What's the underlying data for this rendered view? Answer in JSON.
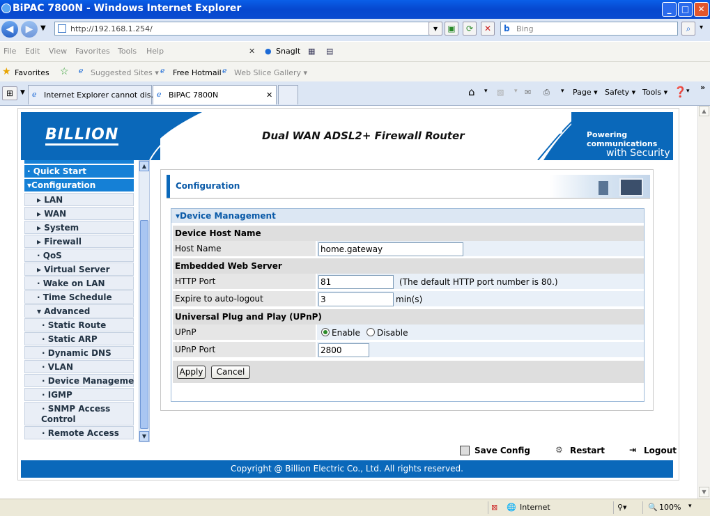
{
  "window": {
    "title": "BiPAC 7800N - Windows Internet Explorer",
    "min": "_",
    "max": "□",
    "close": "✕"
  },
  "addressbar": {
    "url": "http://192.168.1.254/",
    "search_placeholder": "Bing",
    "search_logo": "b"
  },
  "menubar": {
    "items": [
      "File",
      "Edit",
      "View",
      "Favorites",
      "Tools",
      "Help"
    ],
    "snagit": "SnagIt"
  },
  "favorites": {
    "label": "Favorites",
    "items": [
      "Suggested Sites ▾",
      "Free Hotmail",
      "Web Slice Gallery ▾"
    ]
  },
  "tabs": [
    {
      "label": "Internet Explorer cannot dis..."
    },
    {
      "label": "BiPAC 7800N"
    }
  ],
  "commandbar": {
    "page": "Page ▾",
    "safety": "Safety ▾",
    "tools": "Tools ▾"
  },
  "banner": {
    "logo": "BILLION",
    "headline": "Dual WAN ADSL2+ Firewall Router",
    "tagline_1": "Powering communications",
    "tagline_2": "with Security"
  },
  "nav": {
    "items": [
      {
        "label": "· Quick Start",
        "style": "blue"
      },
      {
        "label": "▾Configuration",
        "style": "blue"
      },
      {
        "label": "▸ LAN",
        "style": "light",
        "indent": 1
      },
      {
        "label": "▸ WAN",
        "style": "light",
        "indent": 1
      },
      {
        "label": "▸ System",
        "style": "light",
        "indent": 1
      },
      {
        "label": "▸ Firewall",
        "style": "light",
        "indent": 1
      },
      {
        "label": "· QoS",
        "style": "light",
        "indent": 1
      },
      {
        "label": "▸ Virtual Server",
        "style": "light",
        "indent": 1
      },
      {
        "label": "· Wake on LAN",
        "style": "light",
        "indent": 1
      },
      {
        "label": "· Time Schedule",
        "style": "light",
        "indent": 1
      },
      {
        "label": "▾ Advanced",
        "style": "light",
        "indent": 1
      },
      {
        "label": "· Static Route",
        "style": "light",
        "indent": 2
      },
      {
        "label": "· Static ARP",
        "style": "light",
        "indent": 2
      },
      {
        "label": "· Dynamic DNS",
        "style": "light",
        "indent": 2
      },
      {
        "label": "· VLAN",
        "style": "light",
        "indent": 2
      },
      {
        "label": "· Device Management",
        "style": "light",
        "indent": 2
      },
      {
        "label": "· IGMP",
        "style": "light",
        "indent": 2
      },
      {
        "label": "· SNMP Access",
        "label2": "Control",
        "style": "light",
        "indent": 2
      },
      {
        "label": "· Remote Access",
        "style": "light",
        "indent": 2
      }
    ]
  },
  "content": {
    "title": "Configuration",
    "panel_title": "▾Device Management",
    "sections": {
      "host": "Device Host Name",
      "web": "Embedded Web Server",
      "upnp": "Universal Plug and Play (UPnP)"
    },
    "host_name_label": "Host Name",
    "host_name_value": "home.gateway",
    "http_port_label": "HTTP Port",
    "http_port_value": "81",
    "http_port_note": "(The default HTTP port number is 80.)",
    "expire_label": "Expire to auto-logout",
    "expire_value": "3",
    "expire_unit": "min(s)",
    "upnp_label": "UPnP",
    "upnp_enable": "Enable",
    "upnp_disable": "Disable",
    "upnp_selected": "Enable",
    "upnp_port_label": "UPnP Port",
    "upnp_port_value": "2800",
    "apply": "Apply",
    "cancel": "Cancel"
  },
  "actions": {
    "save": "Save Config",
    "restart": "Restart",
    "logout": "Logout"
  },
  "footer": {
    "copyright": "Copyright @ Billion Electric Co., Ltd. All rights reserved."
  },
  "statusbar": {
    "zone": "Internet",
    "zoom": "100%"
  },
  "colors": {
    "accent": "#0a68ba",
    "ie_title": "#0648cf",
    "nav_blue": "#1580d6"
  }
}
